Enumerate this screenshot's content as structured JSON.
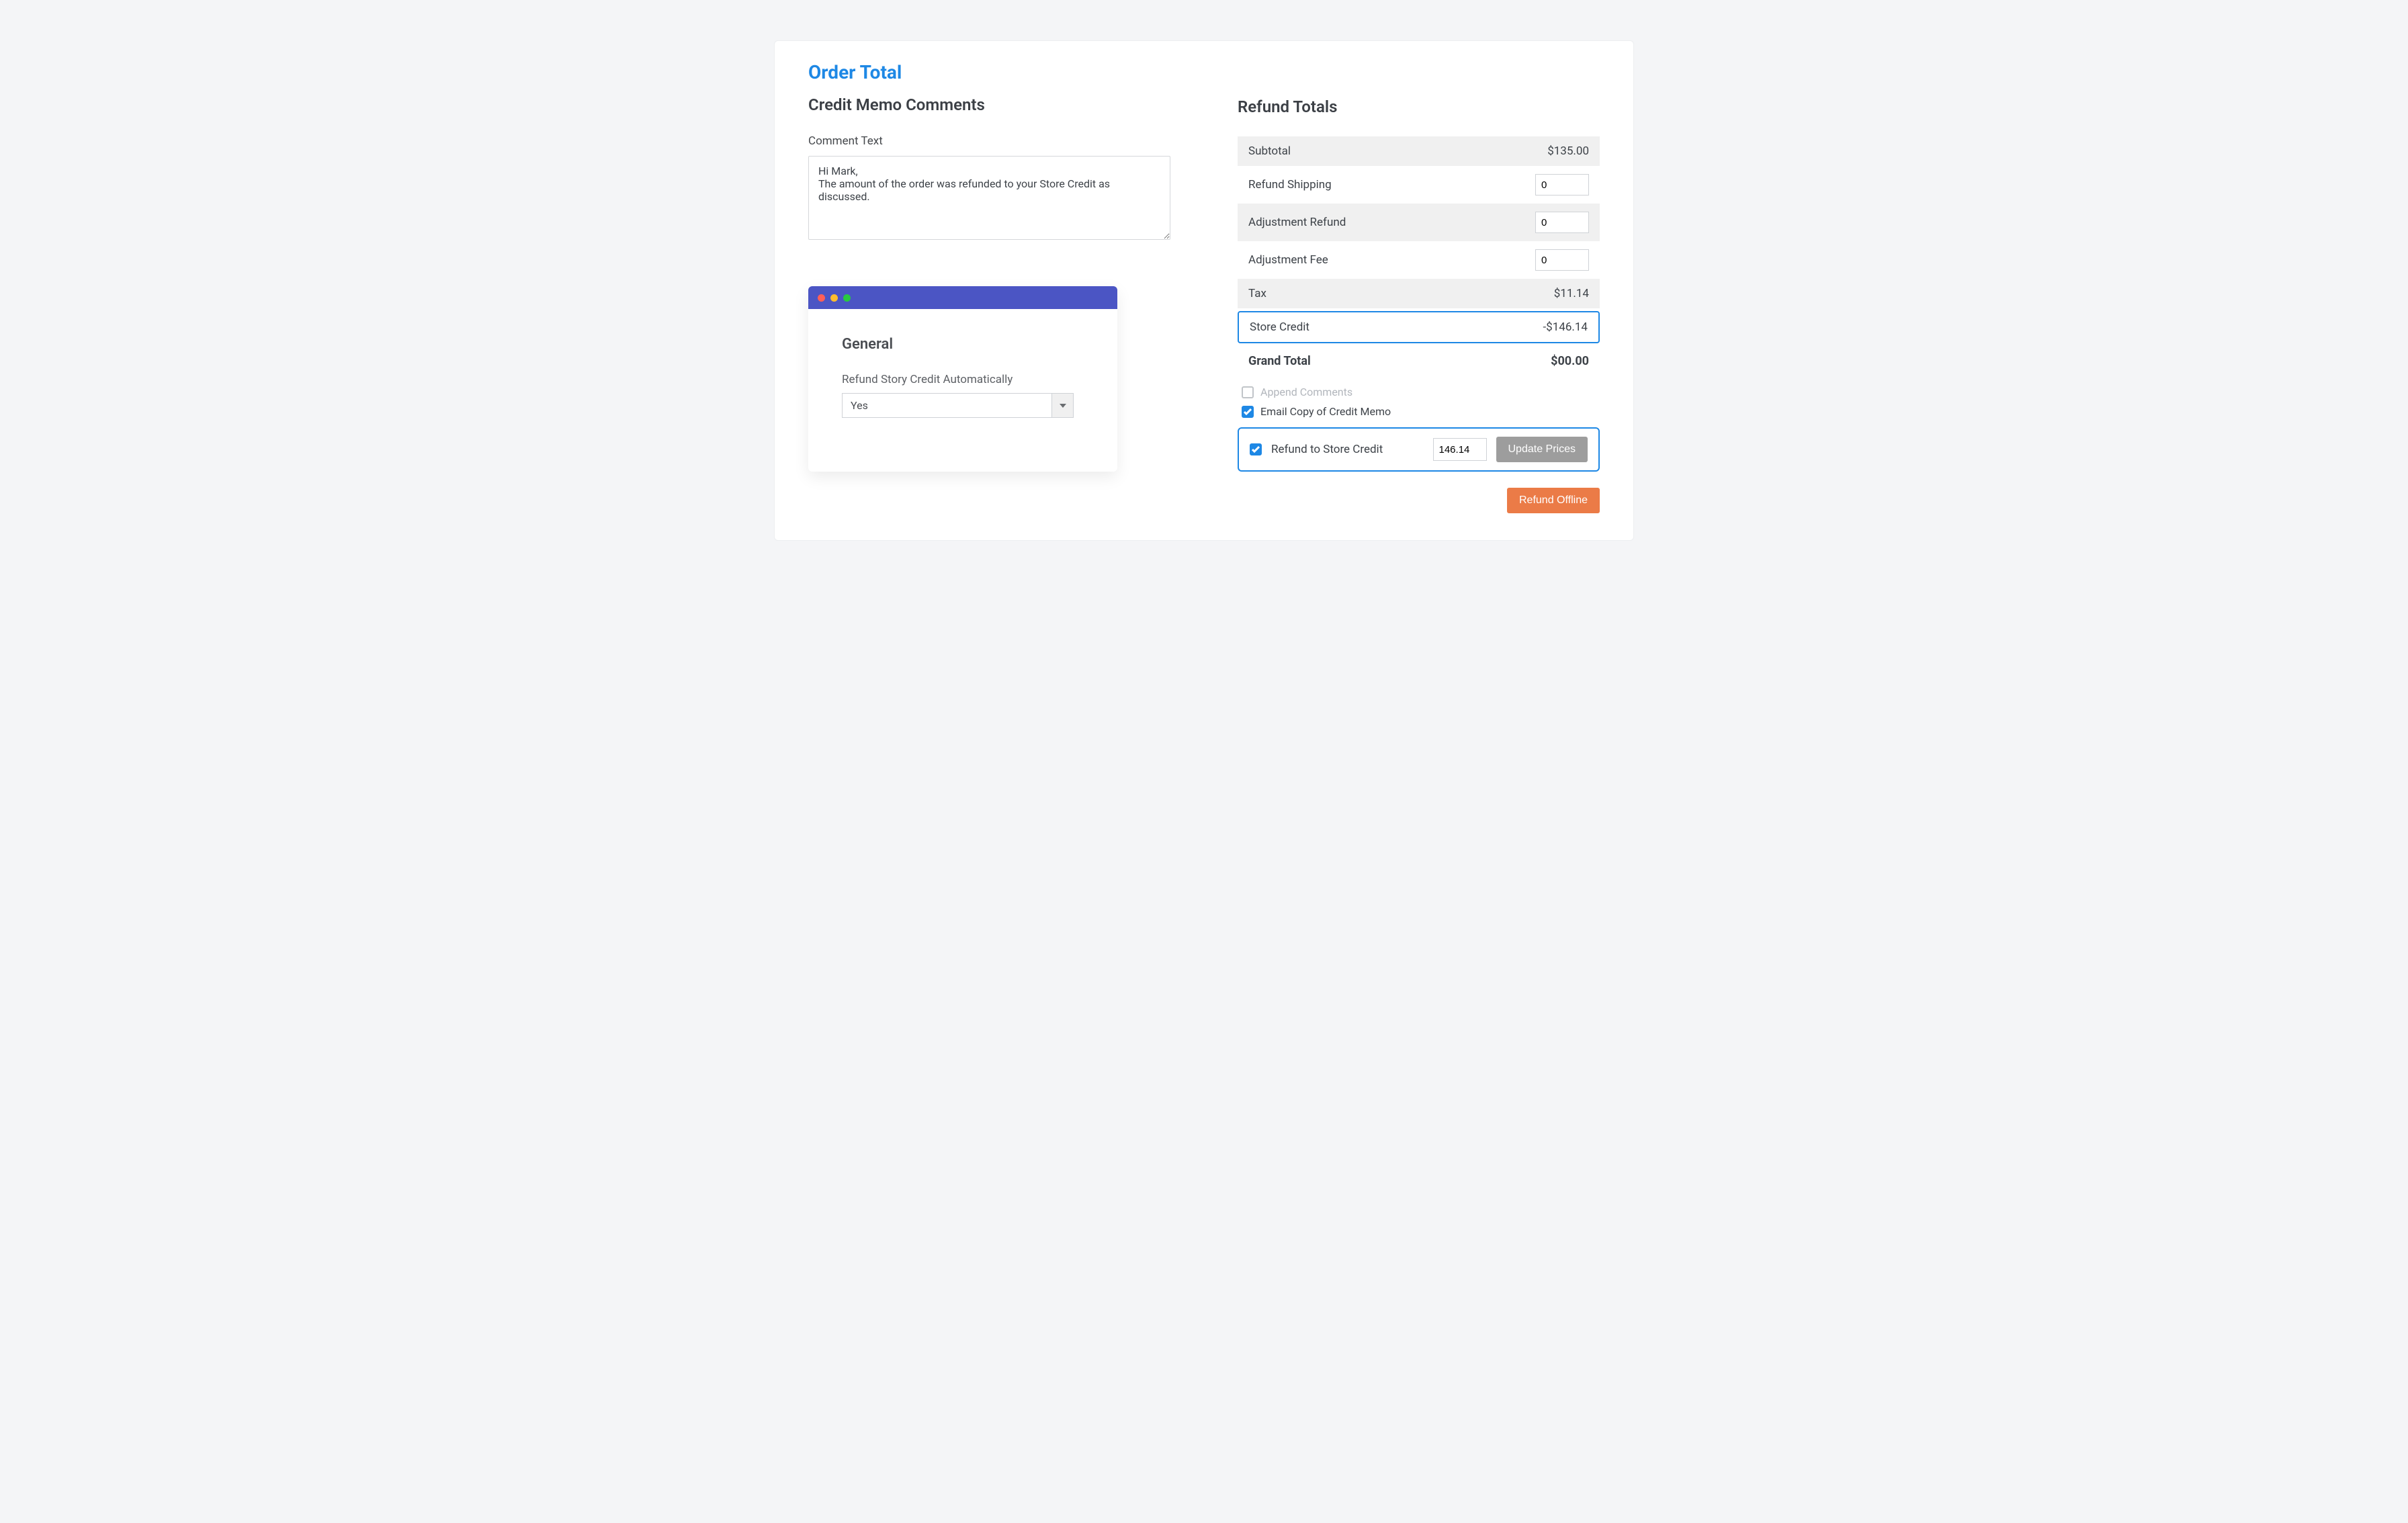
{
  "header": {
    "page_title": "Order Total"
  },
  "left": {
    "section_title": "Credit Memo Comments",
    "comment_label": "Comment Text",
    "comment_value": "Hi Mark,\nThe amount of the order was refunded to your Store Credit as discussed."
  },
  "mini": {
    "heading": "General",
    "refund_auto_label": "Refund Story Credit Automatically",
    "refund_auto_value": "Yes"
  },
  "right": {
    "section_title": "Refund Totals",
    "rows": {
      "subtotal_label": "Subtotal",
      "subtotal_value": "$135.00",
      "refund_shipping_label": "Refund Shipping",
      "refund_shipping_value": "0",
      "adjustment_refund_label": "Adjustment Refund",
      "adjustment_refund_value": "0",
      "adjustment_fee_label": "Adjustment Fee",
      "adjustment_fee_value": "0",
      "tax_label": "Tax",
      "tax_value": "$11.14",
      "store_credit_label": "Store Credit",
      "store_credit_value": "-$146.14",
      "grand_total_label": "Grand Total",
      "grand_total_value": "$00.00"
    },
    "checks": {
      "append_comments": "Append Comments",
      "email_copy": "Email Copy of Credit Memo",
      "refund_to_store_credit": "Refund to Store Credit",
      "refund_amount": "146.14",
      "update_prices": "Update Prices"
    },
    "refund_offline": "Refund Offline"
  }
}
